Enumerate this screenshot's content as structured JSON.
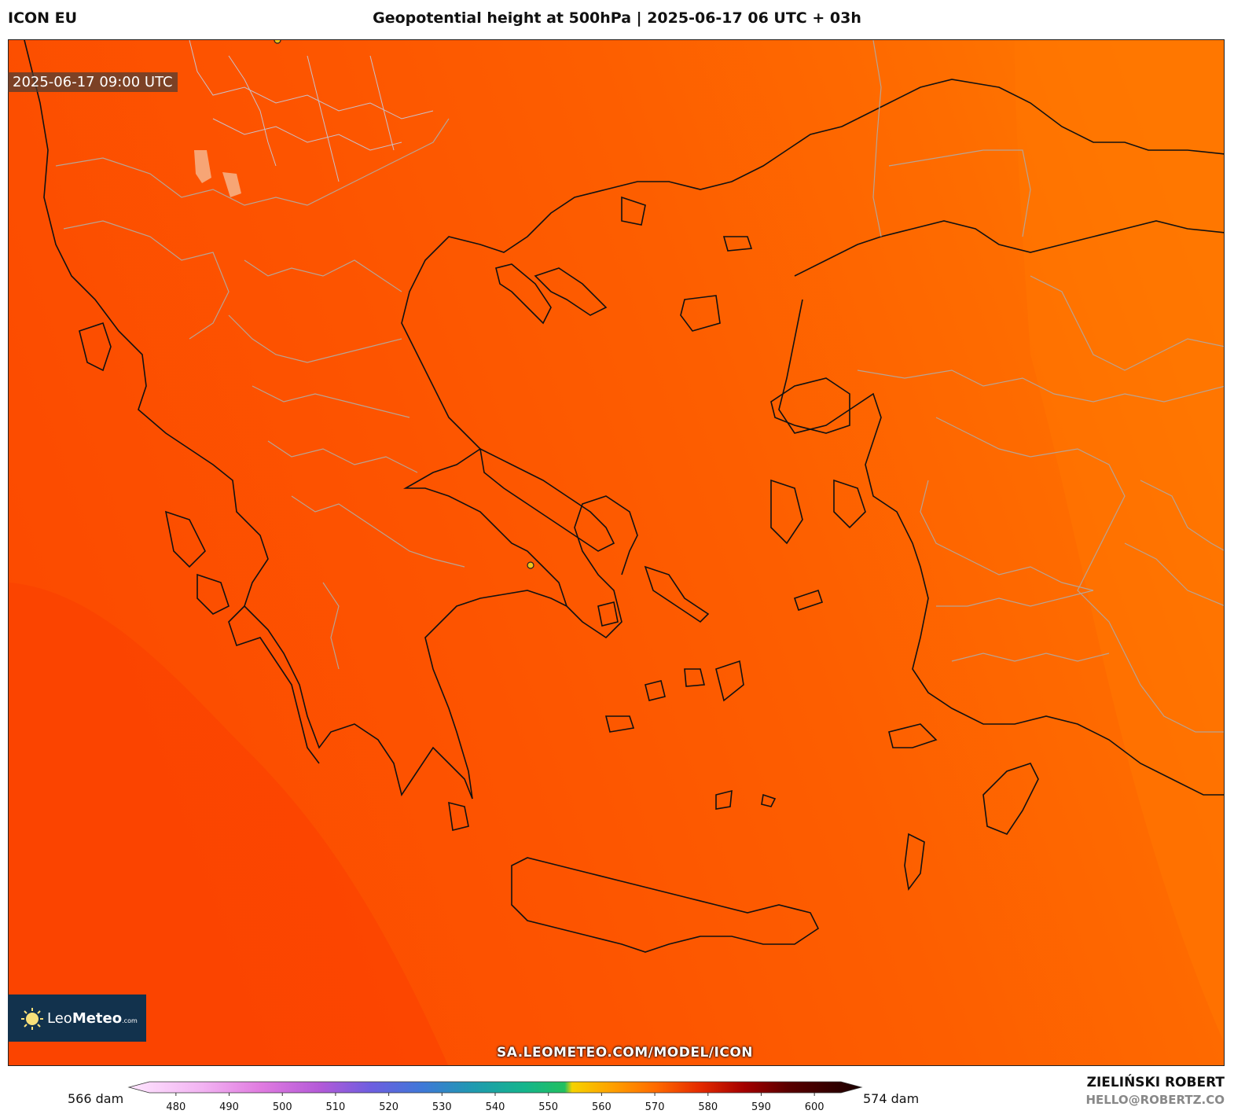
{
  "header": {
    "model": "ICON EU",
    "title": "Geopotential height at 500hPa | 2025-06-17 06 UTC + 03h"
  },
  "map": {
    "valid_time": "2025-06-17 09:00 UTC",
    "region": "Greece / Aegean Sea",
    "field_colors": {
      "west": "#fc4600",
      "center": "#fd5a00",
      "east": "#fe7400"
    }
  },
  "logo": {
    "icon": "sun-icon",
    "brand_light": "Leo",
    "brand_bold": "Meteo",
    "brand_suffix": ".com"
  },
  "watermark": {
    "url": "SA.LEOMETEO.COM/MODEL/ICON"
  },
  "colorbar": {
    "min_label": "566 dam",
    "max_label": "574 dam",
    "ticks": [
      "480",
      "490",
      "500",
      "510",
      "520",
      "530",
      "540",
      "550",
      "560",
      "570",
      "580",
      "590",
      "600"
    ],
    "range": [
      475,
      605
    ]
  },
  "credits": {
    "author": "ZIELIŃSKI ROBERT",
    "email": "HELLO@ROBERTZ.CO"
  }
}
